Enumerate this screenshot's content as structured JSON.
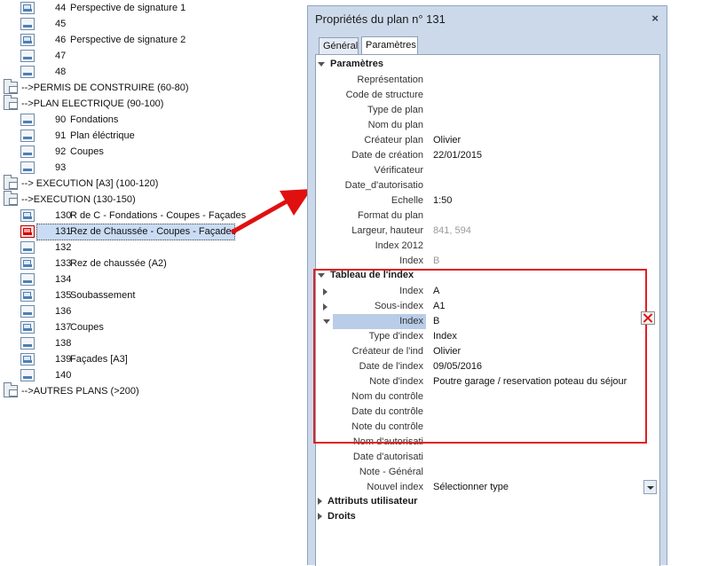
{
  "tree": {
    "items": [
      {
        "type": "leaf",
        "icon": "sheet-image-icon",
        "num": "44",
        "label": "Perspective de signature 1"
      },
      {
        "type": "leaf",
        "icon": "sheet-icon",
        "num": "45",
        "label": ""
      },
      {
        "type": "leaf",
        "icon": "sheet-image-icon",
        "num": "46",
        "label": "Perspective de signature 2"
      },
      {
        "type": "leaf",
        "icon": "sheet-icon",
        "num": "47",
        "label": ""
      },
      {
        "type": "leaf",
        "icon": "sheet-icon",
        "num": "48",
        "label": ""
      },
      {
        "type": "group",
        "icon": "folder-icon",
        "label": "-->PERMIS DE CONSTRUIRE (60-80)"
      },
      {
        "type": "group",
        "icon": "folder-icon",
        "label": "-->PLAN ELECTRIQUE (90-100)"
      },
      {
        "type": "leaf",
        "icon": "sheet-icon",
        "num": "90",
        "label": "Fondations"
      },
      {
        "type": "leaf",
        "icon": "sheet-icon",
        "num": "91",
        "label": "Plan éléctrique"
      },
      {
        "type": "leaf",
        "icon": "sheet-icon",
        "num": "92",
        "label": "Coupes"
      },
      {
        "type": "leaf",
        "icon": "sheet-icon",
        "num": "93",
        "label": ""
      },
      {
        "type": "group",
        "icon": "folder-icon",
        "label": "--> EXECUTION [A3] (100-120)"
      },
      {
        "type": "group",
        "icon": "folder-icon",
        "label": "-->EXECUTION (130-150)"
      },
      {
        "type": "leaf",
        "icon": "sheet-image-icon",
        "num": "130",
        "label": "R de C - Fondations - Coupes - Façades"
      },
      {
        "type": "leaf",
        "icon": "sheet-red-icon",
        "num": "131",
        "label": "Rez de Chaussée - Coupes - Façades",
        "selected": true
      },
      {
        "type": "leaf",
        "icon": "sheet-icon",
        "num": "132",
        "label": ""
      },
      {
        "type": "leaf",
        "icon": "sheet-image-icon",
        "num": "133",
        "label": "Rez de chaussée (A2)"
      },
      {
        "type": "leaf",
        "icon": "sheet-icon",
        "num": "134",
        "label": ""
      },
      {
        "type": "leaf",
        "icon": "sheet-image-icon",
        "num": "135",
        "label": "Soubassement"
      },
      {
        "type": "leaf",
        "icon": "sheet-icon",
        "num": "136",
        "label": ""
      },
      {
        "type": "leaf",
        "icon": "sheet-image-icon",
        "num": "137",
        "label": "Coupes"
      },
      {
        "type": "leaf",
        "icon": "sheet-icon",
        "num": "138",
        "label": ""
      },
      {
        "type": "leaf",
        "icon": "sheet-image-icon",
        "num": "139",
        "label": "Façades [A3]"
      },
      {
        "type": "leaf",
        "icon": "sheet-icon",
        "num": "140",
        "label": ""
      },
      {
        "type": "group",
        "icon": "folder-icon",
        "label": "-->AUTRES PLANS (>200)"
      }
    ]
  },
  "dialog": {
    "title": "Propriétés du plan n° 131",
    "close_icon": "×",
    "tabs": [
      {
        "label": "Général",
        "active": false
      },
      {
        "label": "Paramètres",
        "active": true
      }
    ],
    "section_params": "Paramètres",
    "params": [
      {
        "label": "Représentation",
        "value": ""
      },
      {
        "label": "Code de structure",
        "value": ""
      },
      {
        "label": "Type de plan",
        "value": ""
      },
      {
        "label": "Nom du plan",
        "value": ""
      },
      {
        "label": "Créateur plan",
        "value": "Olivier"
      },
      {
        "label": "Date de création",
        "value": "22/01/2015"
      },
      {
        "label": "Vérificateur",
        "value": ""
      },
      {
        "label": "Date_d'autorisatio",
        "value": ""
      },
      {
        "label": "Echelle",
        "value": "1:50"
      },
      {
        "label": "Format du plan",
        "value": ""
      },
      {
        "label": "Largeur, hauteur",
        "value": "841, 594",
        "grey": true
      },
      {
        "label": "Index 2012",
        "value": ""
      },
      {
        "label": "Index",
        "value": "B",
        "grey": true
      }
    ],
    "section_index": "Tableau de l'index",
    "index_rows": [
      {
        "label": "Index",
        "value": "A",
        "expander": "right"
      },
      {
        "label": "Sous-index",
        "value": "A1",
        "expander": "right"
      },
      {
        "label": "Index",
        "value": "B",
        "expander": "down",
        "highlight": true,
        "delete": true
      },
      {
        "label": "Type d'index",
        "value": "Index"
      },
      {
        "label": "Créateur de l'ind",
        "value": "Olivier"
      },
      {
        "label": "Date de l'index",
        "value": "09/05/2016"
      },
      {
        "label": "Note d'index",
        "value": "Poutre garage / reservation poteau du séjour"
      },
      {
        "label": "Nom du contrôle",
        "value": ""
      },
      {
        "label": "Date du contrôle",
        "value": ""
      },
      {
        "label": "Note du contrôle",
        "value": ""
      },
      {
        "label": "Nom d'autorisati",
        "value": ""
      },
      {
        "label": "Date d'autorisati",
        "value": ""
      },
      {
        "label": "Note - Général",
        "value": ""
      },
      {
        "label": "Nouvel index",
        "value": "Sélectionner type",
        "dropdown": true
      }
    ],
    "section_attr": "Attributs utilisateur",
    "section_rights": "Droits"
  }
}
